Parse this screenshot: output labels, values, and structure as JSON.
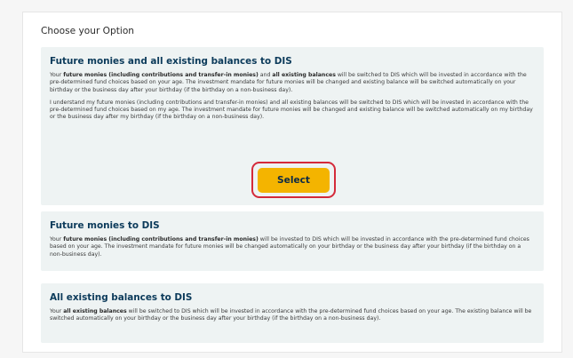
{
  "page": {
    "heading": "Choose your Option"
  },
  "options": [
    {
      "title": "Future monies and all existing balances to DIS",
      "p1": {
        "pre": "Your ",
        "bold1": "future monies (including contributions and transfer-in monies)",
        "mid": " and ",
        "bold2": "all existing balances",
        "post": " will be switched to DIS which will be invested in accordance with the pre-determined fund choices based on your age. The investment mandate for future monies will be changed and existing balance will be switched automatically on your birthday or the business day after your birthday (if the birthday on a non-business day)."
      },
      "p2": "I understand my future monies (including contributions and transfer-in monies) and all existing balances will be switched to DIS which will be invested in accordance with the pre-determined fund choices based on my age. The investment mandate for future monies will be changed and existing balance will be switched automatically on my birthday or the business day after my birthday (if the birthday on a non-business day).",
      "button_label": "Select"
    },
    {
      "title": "Future monies to DIS",
      "p1": {
        "pre": "Your ",
        "bold": "future monies (including contributions and transfer-in monies)",
        "post": " will be invested to DIS which will be invested in accordance with the pre-determined fund choices based on your age. The investment mandate for future monies will be changed automatically on your birthday or the business day after your birthday (if the birthday on a non-business day)."
      }
    },
    {
      "title": "All existing balances to DIS",
      "p1": {
        "pre": "Your ",
        "bold": "all existing balances",
        "post": " will be switched to DIS which will be invested in accordance with the pre-determined fund choices based on your age. The existing balance will be switched automatically on your birthday or the business day after your birthday (if the birthday on a non-business day)."
      }
    }
  ],
  "colors": {
    "accent_button": "#f4b400",
    "highlight_border": "#d42a3a",
    "title_text": "#0b3a5a",
    "card_background": "#eef3f3"
  }
}
